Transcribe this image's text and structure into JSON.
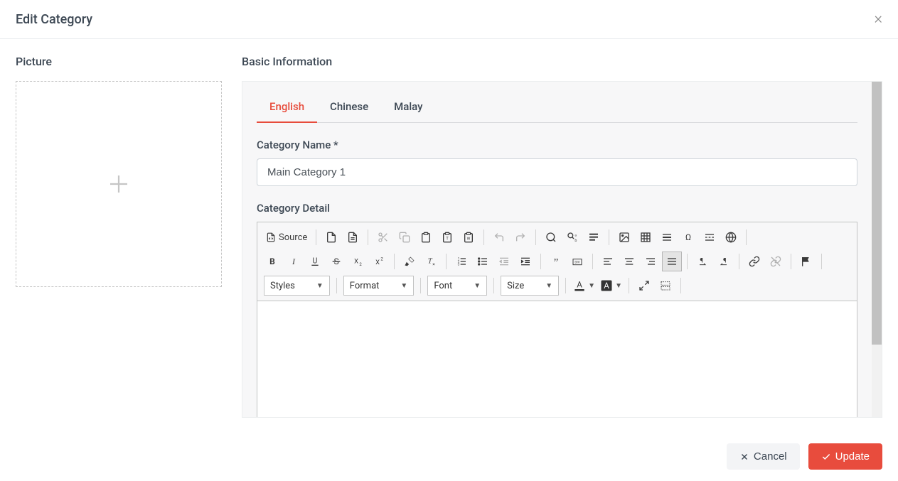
{
  "modal": {
    "title": "Edit Category"
  },
  "picture": {
    "label": "Picture"
  },
  "basic": {
    "label": "Basic Information",
    "tabs": [
      "English",
      "Chinese",
      "Malay"
    ],
    "active_tab_index": 0,
    "category_name_label": "Category Name *",
    "category_name_value": "Main Category 1",
    "category_detail_label": "Category Detail"
  },
  "editor": {
    "source_label": "Source",
    "styles_label": "Styles",
    "format_label": "Format",
    "font_label": "Font",
    "size_label": "Size"
  },
  "footer": {
    "cancel_label": "Cancel",
    "update_label": "Update"
  }
}
